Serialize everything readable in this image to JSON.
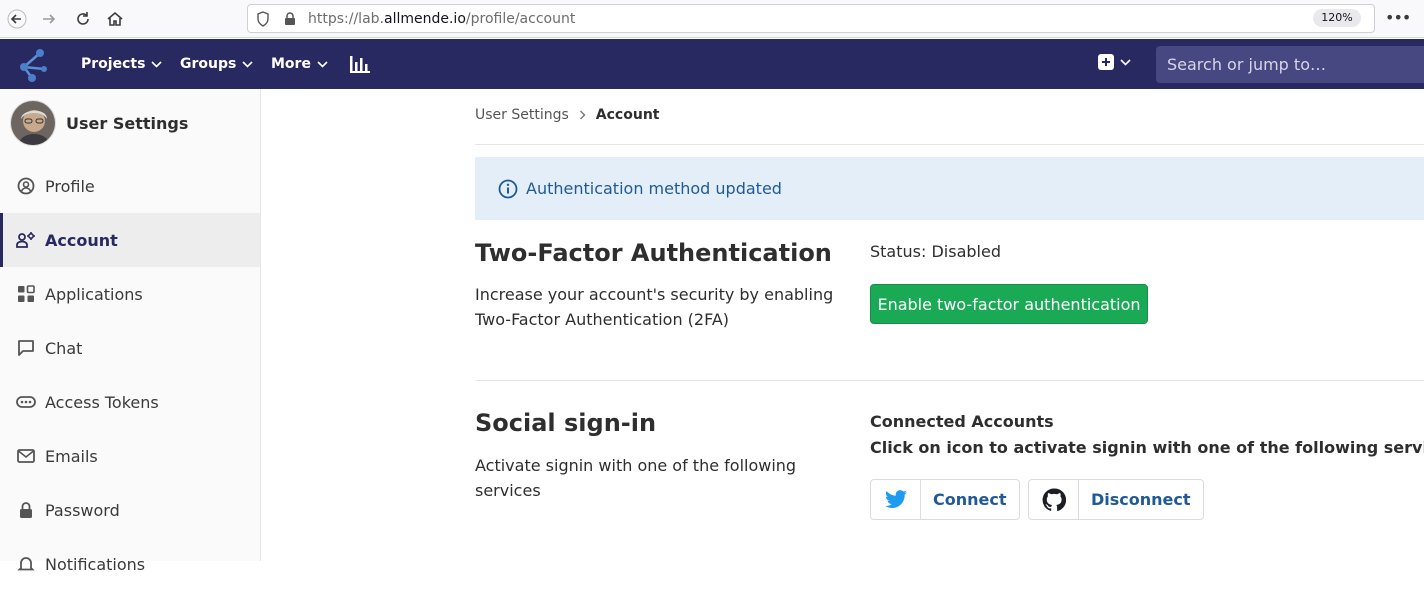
{
  "browser": {
    "url_prefix": "https://lab.",
    "url_domain": "allmende.io",
    "url_path": "/profile/account",
    "zoom": "120%"
  },
  "header": {
    "nav": [
      "Projects",
      "Groups",
      "More"
    ],
    "search_placeholder": "Search or jump to…"
  },
  "sidebar": {
    "title": "User Settings",
    "items": [
      {
        "label": "Profile",
        "icon": "profile-icon"
      },
      {
        "label": "Account",
        "icon": "account-icon",
        "active": true
      },
      {
        "label": "Applications",
        "icon": "applications-icon"
      },
      {
        "label": "Chat",
        "icon": "chat-icon"
      },
      {
        "label": "Access Tokens",
        "icon": "token-icon"
      },
      {
        "label": "Emails",
        "icon": "mail-icon"
      },
      {
        "label": "Password",
        "icon": "lock-icon"
      },
      {
        "label": "Notifications",
        "icon": "bell-icon"
      }
    ]
  },
  "breadcrumb": {
    "parent": "User Settings",
    "current": "Account"
  },
  "flash": {
    "message": "Authentication method updated"
  },
  "two_factor": {
    "title": "Two-Factor Authentication",
    "description": "Increase your account's security by enabling Two-Factor Authentication (2FA)",
    "status": "Status: Disabled",
    "button": "Enable two-factor authentication"
  },
  "social": {
    "title": "Social sign-in",
    "description": "Activate signin with one of the following services",
    "connected_title": "Connected Accounts",
    "connected_subtitle": "Click on icon to activate signin with one of the following services",
    "providers": [
      {
        "icon": "twitter-icon",
        "action": "Connect"
      },
      {
        "icon": "github-icon",
        "action": "Disconnect"
      }
    ]
  },
  "colors": {
    "nav_bg": "#292961",
    "accent": "#1aaa55",
    "link": "#1f5a96",
    "flash_bg": "#e4eef8"
  }
}
